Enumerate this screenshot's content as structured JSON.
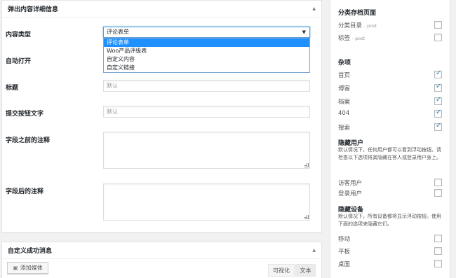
{
  "main_box": {
    "title": "弹出内容详细信息",
    "fields": {
      "content_type": {
        "label": "内容类型",
        "selected": "评论表单",
        "options": [
          "评论表单",
          "Woo产品评级表",
          "自定义内容",
          "自定义链接"
        ]
      },
      "auto_open": {
        "label": "自动打开"
      },
      "title": {
        "label": "标题",
        "placeholder": "默认"
      },
      "submit_text": {
        "label": "提交按钮文字",
        "placeholder": "默认"
      },
      "before_note": {
        "label": "字段之前的注释"
      },
      "after_note": {
        "label": "字段后的注释"
      }
    }
  },
  "success_box": {
    "title": "自定义成功消息",
    "add_media": "添加媒体",
    "tab_visual": "可视化",
    "tab_text": "文本"
  },
  "sidebar": {
    "archive_heading": "分类存档页面",
    "archive_items": [
      {
        "label": "分类目录",
        "suffix": "- post",
        "checked": false
      },
      {
        "label": "标签",
        "suffix": "- post",
        "checked": false
      }
    ],
    "misc_heading": "杂项",
    "misc_items": [
      {
        "label": "首页",
        "checked": true
      },
      {
        "label": "博客",
        "checked": true
      },
      {
        "label": "档案",
        "checked": true
      },
      {
        "label": "404",
        "checked": true
      },
      {
        "label": "搜索",
        "checked": true
      }
    ],
    "hide_users_heading": "隐藏用户",
    "hide_users_desc": "默认情况下，任何用户都可以看到浮动按钮。请检查以下选项将其隐藏在客人或登录用户身上。",
    "user_items": [
      {
        "label": "访客用户",
        "checked": false
      },
      {
        "label": "登录用户",
        "checked": false
      }
    ],
    "hide_devices_heading": "隐藏设备",
    "hide_devices_desc": "默认情况下，所有设备都将显示浮动按钮。使用下面的选项来隐藏它们。",
    "device_items": [
      {
        "label": "移动",
        "checked": false
      },
      {
        "label": "平板",
        "checked": false
      },
      {
        "label": "桌面",
        "checked": false
      }
    ]
  },
  "colors": {
    "accent": "#1e8cbe",
    "selected_option": "#1e90ff"
  }
}
